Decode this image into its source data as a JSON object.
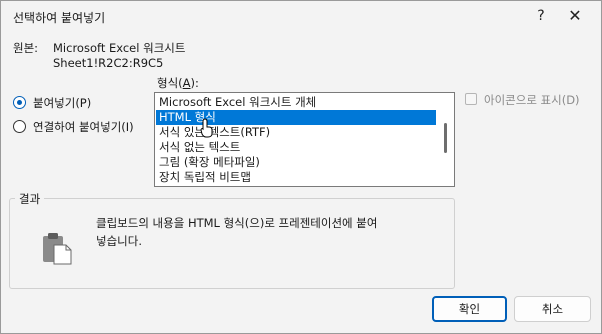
{
  "dialog": {
    "title": "선택하여 붙여넣기",
    "help_glyph": "?",
    "close_glyph": "✕"
  },
  "source": {
    "label": "원본:",
    "app": "Microsoft Excel 워크시트",
    "range": "Sheet1!R2C2:R9C5"
  },
  "format": {
    "label_prefix": "형식(",
    "label_key": "A",
    "label_suffix": "):",
    "items": [
      "Microsoft Excel 워크시트 개체",
      "HTML 형식",
      "서식 있는 텍스트(RTF)",
      "서식 없는 텍스트",
      "그림 (확장 메타파일)",
      "장치 독립적 비트맵"
    ],
    "selected_index": 1
  },
  "paste_options": {
    "paste": "붙여넣기(P)",
    "paste_link": "연결하여 붙여넣기(I)",
    "selected": "paste"
  },
  "display_as_icon": "아이콘으로 표시(D)",
  "result": {
    "label": "결과",
    "text": "클립보드의 내용을 HTML 형식(으)로 프레젠테이션에 붙여\n넣습니다."
  },
  "buttons": {
    "ok": "확인",
    "cancel": "취소"
  },
  "colors": {
    "accent": "#005fb8",
    "selection": "#0078d7"
  }
}
